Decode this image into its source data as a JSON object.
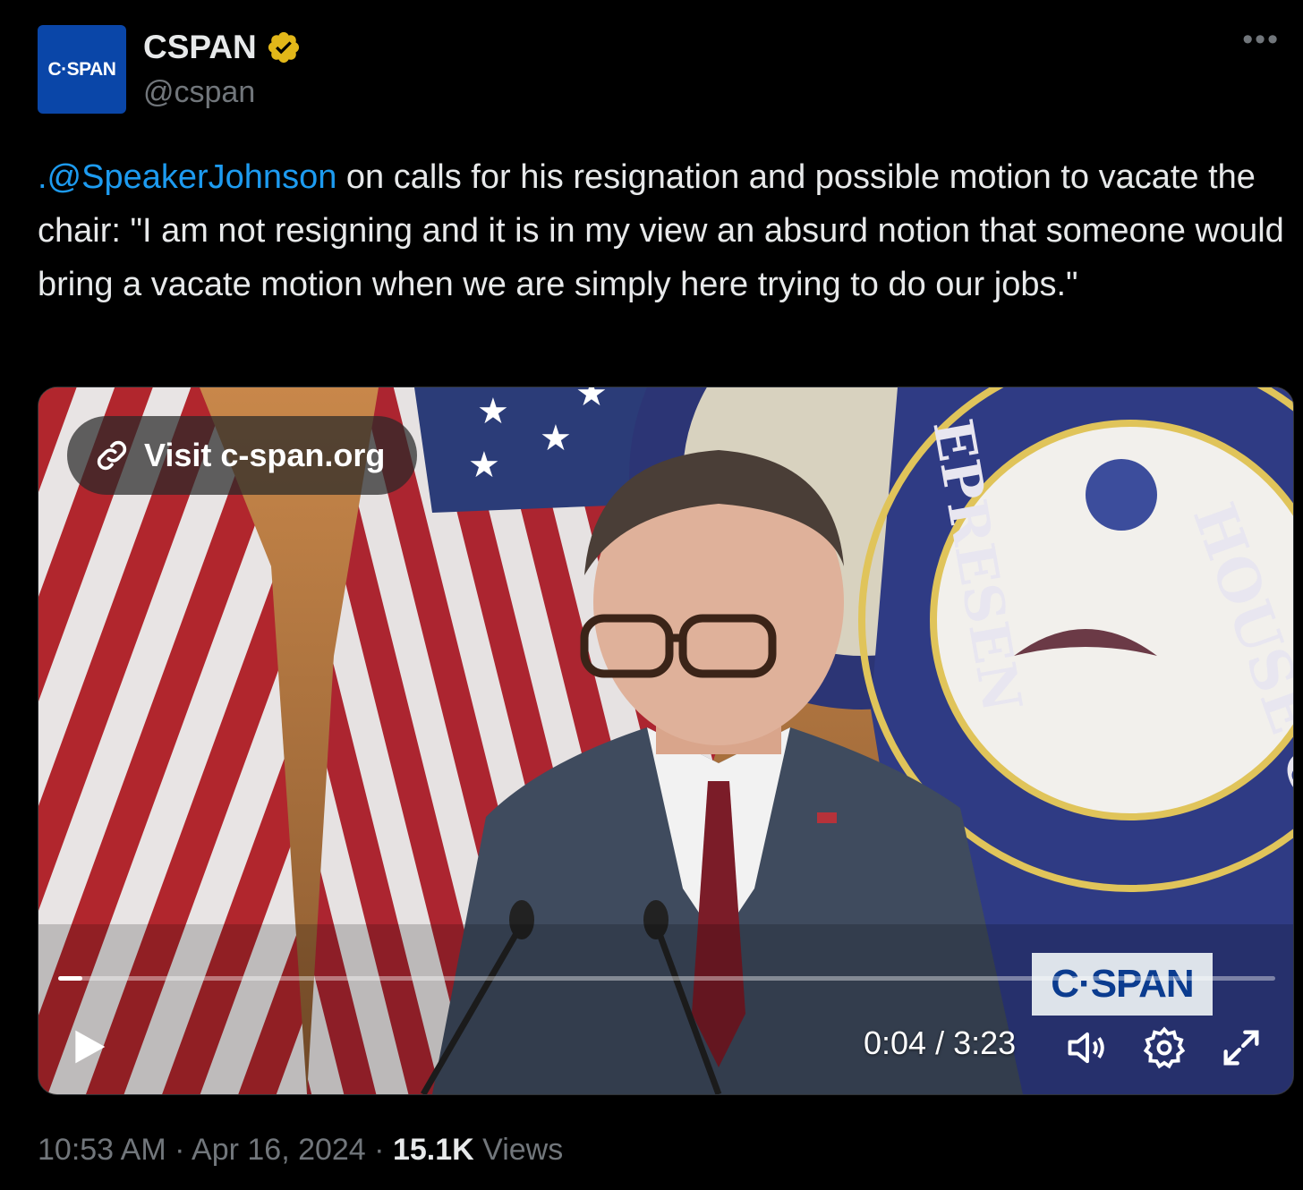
{
  "author": {
    "avatar_text": "C·SPAN",
    "display_name": "CSPAN",
    "handle": "@cspan",
    "verified_color": "#e2b719"
  },
  "tweet": {
    "mention": ".@SpeakerJohnson",
    "text": " on calls for his resignation and possible motion to vacate the chair: \"I am not resigning and it is in my view an absurd notion that someone would bring a vacate motion when we are simply here trying to do our jobs.\""
  },
  "video": {
    "visit_label": "Visit c-span.org",
    "watermark": "C·SPAN",
    "current_time": "0:04",
    "separator": " / ",
    "duration": "3:23",
    "progress_fraction": 0.02
  },
  "meta": {
    "time": "10:53 AM",
    "date": "Apr 16, 2024",
    "views_count": "15.1K",
    "views_label": "Views",
    "dot": "·"
  },
  "colors": {
    "mention": "#1d9bf0",
    "background": "#000000",
    "muted": "#71767b"
  }
}
